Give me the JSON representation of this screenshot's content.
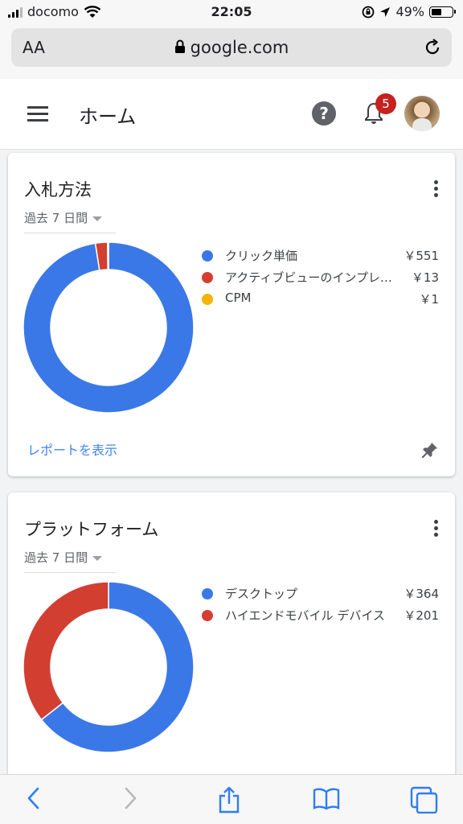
{
  "status_bar": {
    "carrier": "docomo",
    "time": "22:05",
    "battery": "49%"
  },
  "browser": {
    "text_size_label": "AA",
    "domain": "google.com"
  },
  "header": {
    "title": "ホーム",
    "notification_count": "5"
  },
  "cards": [
    {
      "title": "入札方法",
      "range": "過去 7 日間",
      "link": "レポートを表示",
      "legend": [
        {
          "label": "クリック単価",
          "value": "￥551",
          "color": "#3b78e7"
        },
        {
          "label": "アクティブビューのインプレッション単価",
          "value": "￥13",
          "color": "#d23f31"
        },
        {
          "label": "CPM",
          "value": "￥1",
          "color": "#f4b400"
        }
      ]
    },
    {
      "title": "プラットフォーム",
      "range": "過去 7 日間",
      "legend": [
        {
          "label": "デスクトップ",
          "value": "￥364",
          "color": "#3b78e7"
        },
        {
          "label": "ハイエンドモバイル デバイス",
          "value": "￥201",
          "color": "#d23f31"
        }
      ]
    }
  ],
  "chart_data": [
    {
      "type": "pie",
      "categories": [
        "クリック単価",
        "アクティブビューのインプレッション単価",
        "CPM"
      ],
      "values": [
        551,
        13,
        1
      ]
    },
    {
      "type": "pie",
      "categories": [
        "デスクトップ",
        "ハイエンドモバイル デバイス"
      ],
      "values": [
        364,
        201
      ]
    }
  ]
}
